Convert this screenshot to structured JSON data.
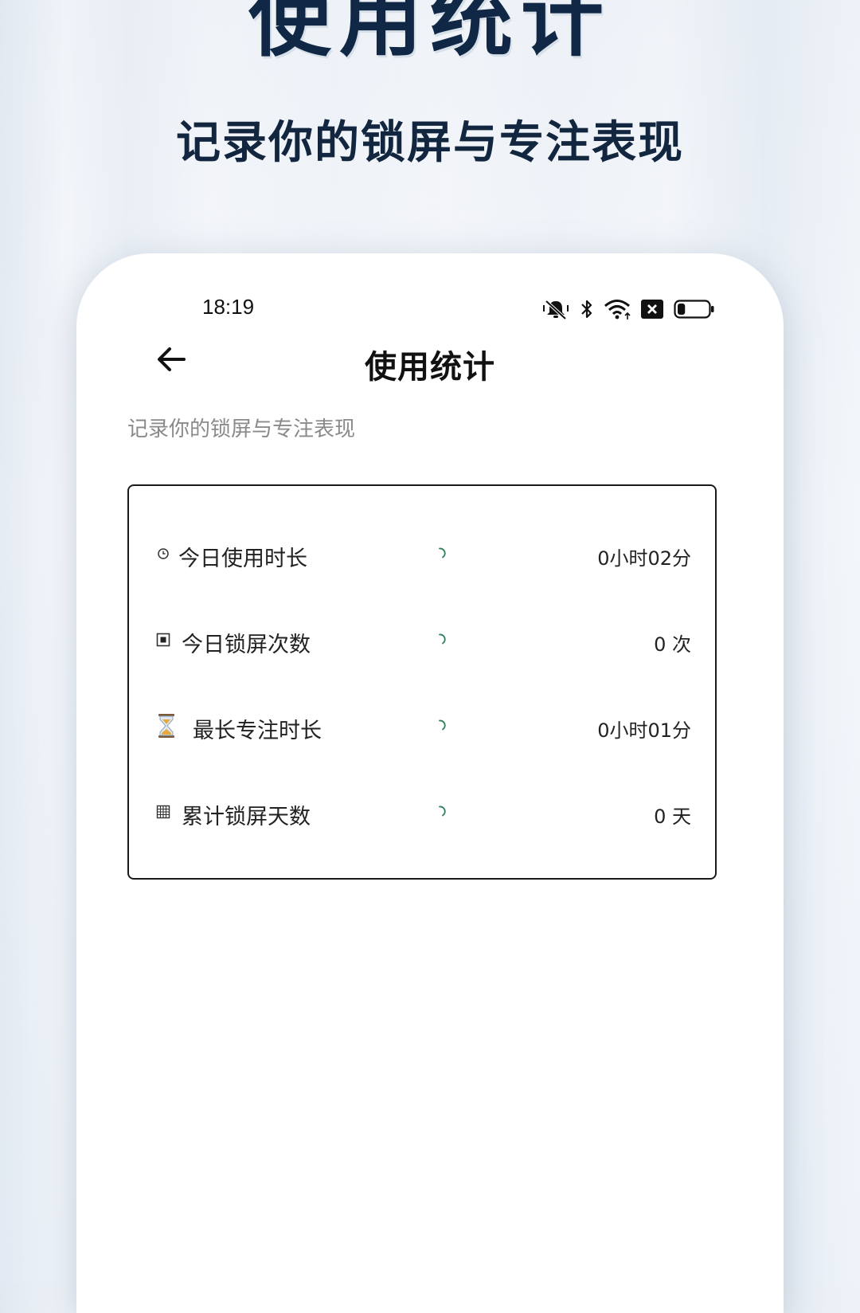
{
  "promo": {
    "title": "使用统计",
    "subtitle": "记录你的锁屏与专注表现"
  },
  "status_bar": {
    "time": "18:19",
    "icons": [
      "mute-icon",
      "bluetooth-icon",
      "wifi-icon",
      "sim-off-icon",
      "battery-icon"
    ],
    "battery_level": 0.25
  },
  "appbar": {
    "back_icon": "arrow-left-icon",
    "title": "使用统计"
  },
  "page_subtitle": "记录你的锁屏与专注表现",
  "stats": [
    {
      "icon": "clock-icon",
      "label": "今日使用时长",
      "value": "0小时02分"
    },
    {
      "icon": "stop-square-icon",
      "label": "今日锁屏次数",
      "value": "0 次"
    },
    {
      "icon": "hourglass-icon",
      "label": "最长专注时长",
      "value": "0小时01分"
    },
    {
      "icon": "calendar-grid-icon",
      "label": "累计锁屏天数",
      "value": "0 天"
    }
  ],
  "colors": {
    "promo_text": "#102845",
    "spinner": "#2e7d5b",
    "card_border": "#1a1a1a",
    "subtitle_gray": "#8a8a8a"
  }
}
